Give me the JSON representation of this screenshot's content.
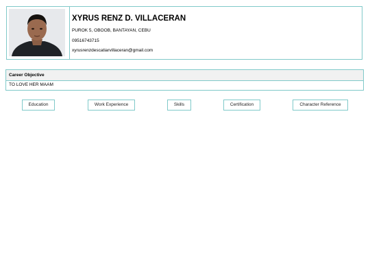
{
  "profile": {
    "name": "XYRUS RENZ D. VILLACERAN",
    "address": "PUROK 5, OBOOB, BANTAYAN, CEBU",
    "phone": "09516743715",
    "email": "xyrusrenzdescatiarvillaceran@gmail.com",
    "photo_icon": "profile-photo"
  },
  "objective": {
    "title": "Career Objective",
    "text": "TO LOVE HER MAAM"
  },
  "nav": [
    {
      "label": "Education"
    },
    {
      "label": "Work Experience"
    },
    {
      "label": "Skills"
    },
    {
      "label": "Certification"
    },
    {
      "label": "Character Reference"
    }
  ],
  "colors": {
    "border": "#7fc9c9",
    "header_bg": "#f1f1f1"
  }
}
